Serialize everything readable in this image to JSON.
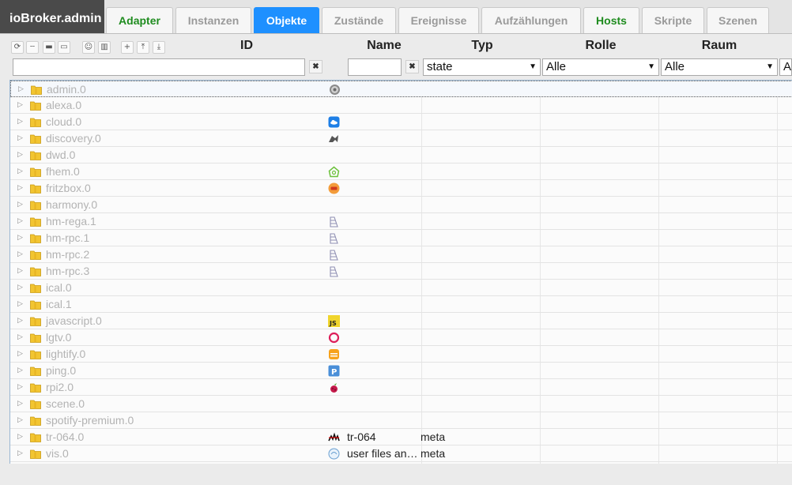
{
  "app": {
    "title": "ioBroker.admin"
  },
  "tabs": [
    {
      "label": "Adapter",
      "style": "green"
    },
    {
      "label": "Instanzen",
      "style": ""
    },
    {
      "label": "Objekte",
      "style": "active"
    },
    {
      "label": "Zustände",
      "style": ""
    },
    {
      "label": "Ereignisse",
      "style": ""
    },
    {
      "label": "Aufzählungen",
      "style": ""
    },
    {
      "label": "Hosts",
      "style": "green"
    },
    {
      "label": "Skripte",
      "style": ""
    },
    {
      "label": "Szenen",
      "style": ""
    }
  ],
  "toolbar": {
    "buttons": [
      "refresh-icon",
      "list-icon",
      "folder-collapse-icon",
      "folder-expand-icon",
      "user-icon",
      "columns-icon",
      "add-icon",
      "upload-icon",
      "download-icon"
    ]
  },
  "columns": {
    "id": "ID",
    "name": "Name",
    "type": "Typ",
    "role": "Rolle",
    "room": "Raum"
  },
  "filters": {
    "id_value": "",
    "name_value": "",
    "type_selected": "state",
    "role_selected": "Alle",
    "room_selected": "Alle",
    "extra_selected": "A"
  },
  "rows": [
    {
      "id": "admin.0",
      "icon": "gear-icon",
      "name": "",
      "type": ""
    },
    {
      "id": "alexa.0",
      "icon": "",
      "name": "",
      "type": ""
    },
    {
      "id": "cloud.0",
      "icon": "cloud-icon",
      "name": "",
      "type": ""
    },
    {
      "id": "discovery.0",
      "icon": "discovery-icon",
      "name": "",
      "type": ""
    },
    {
      "id": "dwd.0",
      "icon": "",
      "name": "",
      "type": ""
    },
    {
      "id": "fhem.0",
      "icon": "fhem-house-icon",
      "name": "",
      "type": ""
    },
    {
      "id": "fritzbox.0",
      "icon": "fritzbox-icon",
      "name": "",
      "type": ""
    },
    {
      "id": "harmony.0",
      "icon": "",
      "name": "",
      "type": ""
    },
    {
      "id": "hm-rega.1",
      "icon": "homematic-icon",
      "name": "",
      "type": ""
    },
    {
      "id": "hm-rpc.1",
      "icon": "homematic-icon",
      "name": "",
      "type": ""
    },
    {
      "id": "hm-rpc.2",
      "icon": "homematic-icon",
      "name": "",
      "type": ""
    },
    {
      "id": "hm-rpc.3",
      "icon": "homematic-icon",
      "name": "",
      "type": ""
    },
    {
      "id": "ical.0",
      "icon": "",
      "name": "",
      "type": ""
    },
    {
      "id": "ical.1",
      "icon": "",
      "name": "",
      "type": ""
    },
    {
      "id": "javascript.0",
      "icon": "javascript-icon",
      "name": "",
      "type": ""
    },
    {
      "id": "lgtv.0",
      "icon": "lgtv-ring-icon",
      "name": "",
      "type": ""
    },
    {
      "id": "lightify.0",
      "icon": "lightify-icon",
      "name": "",
      "type": ""
    },
    {
      "id": "ping.0",
      "icon": "ping-icon",
      "name": "",
      "type": ""
    },
    {
      "id": "rpi2.0",
      "icon": "raspberry-icon",
      "name": "",
      "type": ""
    },
    {
      "id": "scene.0",
      "icon": "",
      "name": "",
      "type": ""
    },
    {
      "id": "spotify-premium.0",
      "icon": "",
      "name": "",
      "type": ""
    },
    {
      "id": "tr-064.0",
      "icon": "tr064-icon",
      "name": "tr-064",
      "type": "meta"
    },
    {
      "id": "vis.0",
      "icon": "vis-icon",
      "name": "user files an…",
      "type": "meta"
    }
  ],
  "colors": {
    "active_tab": "#1e90ff",
    "green_tab": "#1f8c1f",
    "brand_bg": "#4a4a4a",
    "folder": "#f2c531"
  }
}
